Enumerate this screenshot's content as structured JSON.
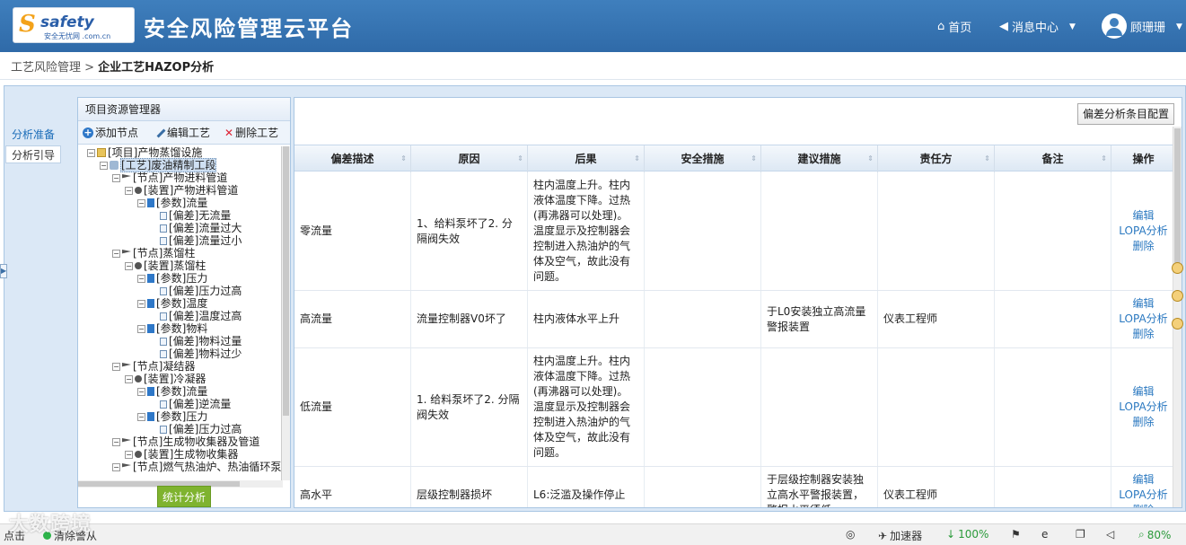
{
  "header": {
    "logo_text": "safety",
    "logo_sub": "安全无忧网 .com.cn",
    "brand_title": "安全风险管理云平台",
    "home": "首页",
    "messages": "消息中心",
    "user": "顾珊珊"
  },
  "breadcrumb": {
    "parent": "工艺风险管理 >",
    "current": "企业工艺HAZOP分析"
  },
  "left_tabs": [
    "分析准备",
    "分析引导"
  ],
  "explorer": {
    "title": "项目资源管理器",
    "add_node": "添加节点",
    "edit_process": "编辑工艺",
    "delete_process": "删除工艺",
    "tree": [
      {
        "label": "[项目]产物蒸馏设施",
        "level": 0,
        "icon": "folder"
      },
      {
        "label": "[工艺]废油精制工段",
        "level": 1,
        "icon": "gear",
        "selected": true
      },
      {
        "label": "[节点]产物进料管道",
        "level": 2,
        "icon": "flag"
      },
      {
        "label": "[装置]产物进料管道",
        "level": 3,
        "icon": "dot"
      },
      {
        "label": "[参数]流量",
        "level": 4,
        "icon": "bar"
      },
      {
        "label": "[偏差]无流量",
        "level": 5,
        "icon": "leaf"
      },
      {
        "label": "[偏差]流量过大",
        "level": 5,
        "icon": "leaf"
      },
      {
        "label": "[偏差]流量过小",
        "level": 5,
        "icon": "leaf"
      },
      {
        "label": "[节点]蒸馏柱",
        "level": 2,
        "icon": "flag"
      },
      {
        "label": "[装置]蒸馏柱",
        "level": 3,
        "icon": "dot"
      },
      {
        "label": "[参数]压力",
        "level": 4,
        "icon": "bar"
      },
      {
        "label": "[偏差]压力过高",
        "level": 5,
        "icon": "leaf"
      },
      {
        "label": "[参数]温度",
        "level": 4,
        "icon": "bar"
      },
      {
        "label": "[偏差]温度过高",
        "level": 5,
        "icon": "leaf"
      },
      {
        "label": "[参数]物料",
        "level": 4,
        "icon": "bar"
      },
      {
        "label": "[偏差]物料过量",
        "level": 5,
        "icon": "leaf"
      },
      {
        "label": "[偏差]物料过少",
        "level": 5,
        "icon": "leaf"
      },
      {
        "label": "[节点]凝结器",
        "level": 2,
        "icon": "flag"
      },
      {
        "label": "[装置]冷凝器",
        "level": 3,
        "icon": "dot"
      },
      {
        "label": "[参数]流量",
        "level": 4,
        "icon": "bar"
      },
      {
        "label": "[偏差]逆流量",
        "level": 5,
        "icon": "leaf"
      },
      {
        "label": "[参数]压力",
        "level": 4,
        "icon": "bar"
      },
      {
        "label": "[偏差]压力过高",
        "level": 5,
        "icon": "leaf"
      },
      {
        "label": "[节点]生成物收集器及管道",
        "level": 2,
        "icon": "flag"
      },
      {
        "label": "[装置]生成物收集器",
        "level": 3,
        "icon": "dot"
      },
      {
        "label": "[节点]燃气热油炉、热油循环泵",
        "level": 2,
        "icon": "flag"
      }
    ],
    "stat_button": "统计分析"
  },
  "grid": {
    "config_button": "偏差分析条目配置",
    "columns": [
      "偏差描述",
      "原因",
      "后果",
      "安全措施",
      "建议措施",
      "责任方",
      "备注",
      "操作"
    ],
    "op_labels": [
      "编辑",
      "LOPA分析",
      "删除"
    ],
    "rows": [
      {
        "deviation": "零流量",
        "cause": "1、给料泵坏了2. 分隔阀失效",
        "consequence": "柱内温度上升。柱内液体温度下降。过热(再沸器可以处理)。温度显示及控制器会控制进入热油炉的气体及空气，故此没有问题。",
        "safety": "",
        "suggestion": "",
        "owner": "",
        "remark": ""
      },
      {
        "deviation": "高流量",
        "cause": "流量控制器V0坏了",
        "consequence": "柱内液体水平上升",
        "safety": "",
        "suggestion": "于L0安装独立高流量警报装置",
        "owner": "仪表工程师",
        "remark": ""
      },
      {
        "deviation": "低流量",
        "cause": "1. 给料泵坏了2. 分隔阀失效",
        "consequence": "柱内温度上升。柱内液体温度下降。过热(再沸器可以处理)。温度显示及控制器会控制进入热油炉的气体及空气，故此没有问题。",
        "safety": "",
        "suggestion": "",
        "owner": "",
        "remark": ""
      },
      {
        "deviation": "高水平",
        "cause": "层级控制器损坏",
        "consequence": "L6:泛滥及操作停止",
        "safety": "",
        "suggestion": "于层级控制器安装独立高水平警报装置，警报水平须低",
        "owner": "仪表工程师",
        "remark": ""
      }
    ]
  },
  "statusbar": {
    "left": "点击",
    "status": "清除警从",
    "accelerator": "加速器",
    "download": "100%",
    "zoom": "80%"
  },
  "watermark": "大数跨境"
}
